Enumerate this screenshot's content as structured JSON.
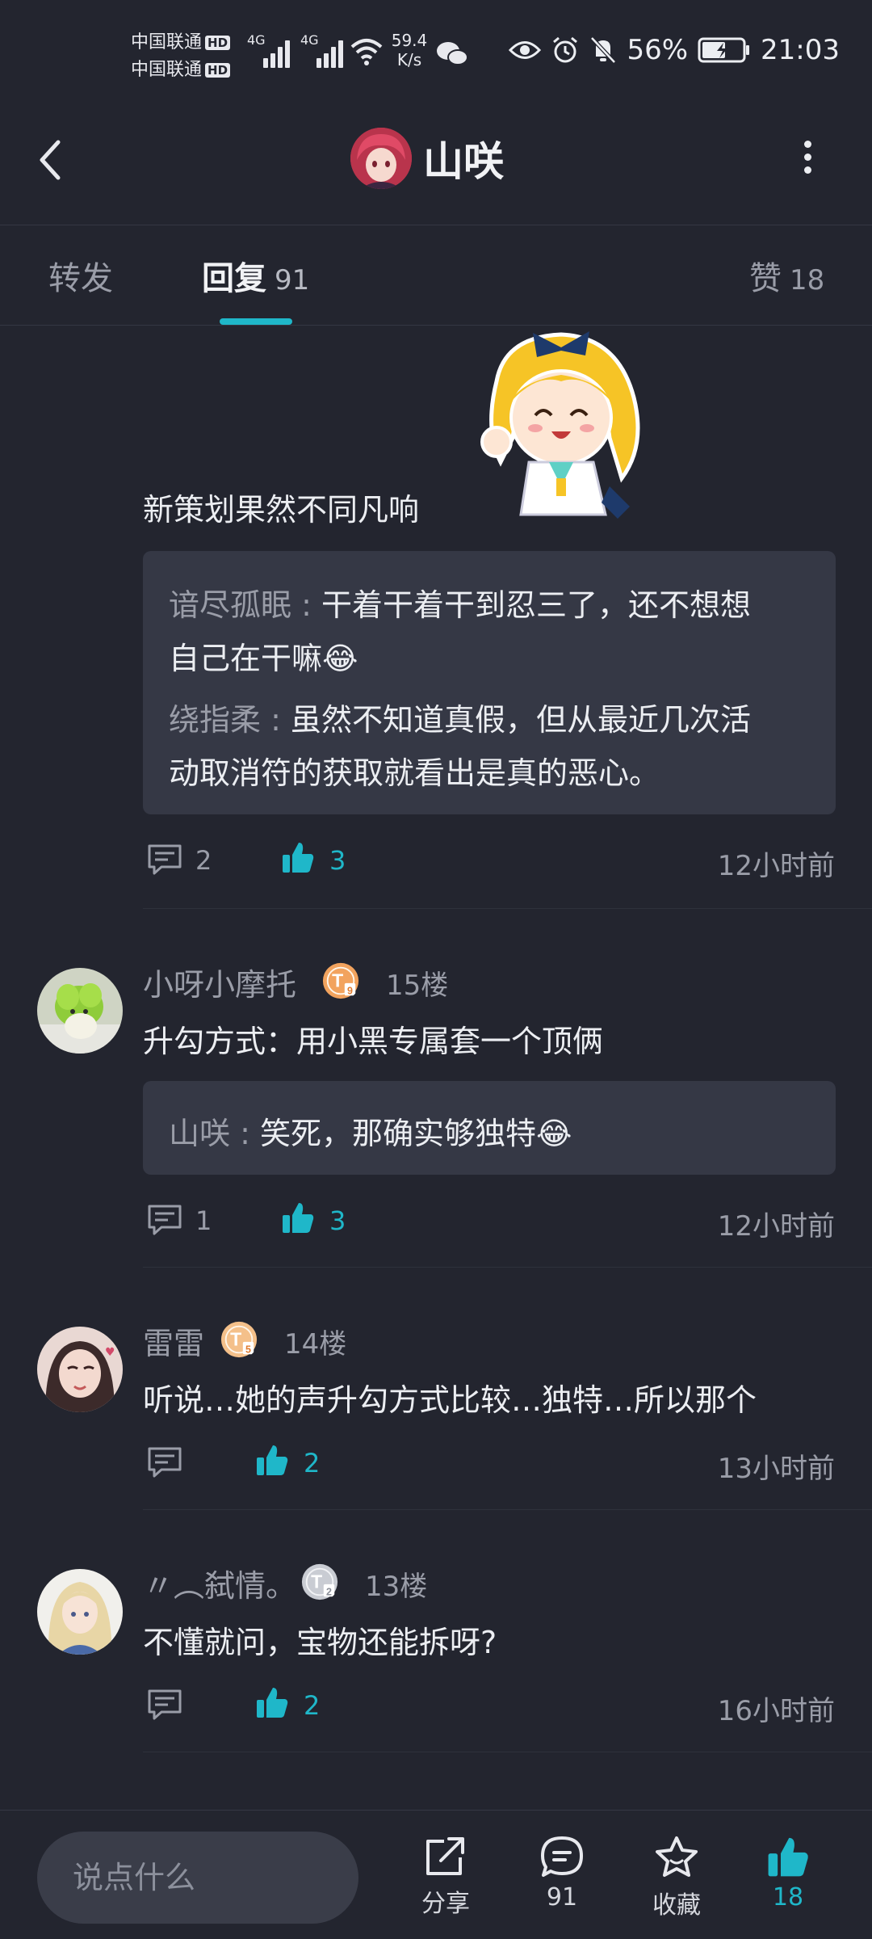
{
  "status_bar": {
    "carrier1": "中国联通",
    "carrier2": "中国联通",
    "hd": "HD",
    "net1": "4G",
    "net2": "4G",
    "speed_value": "59.4",
    "speed_unit": "K/s",
    "battery": "56%",
    "time": "21:03"
  },
  "header": {
    "title": "山咲"
  },
  "tabs": [
    {
      "label": "转发",
      "count": ""
    },
    {
      "label": "回复",
      "count": "91"
    },
    {
      "label": "赞",
      "count": "18"
    }
  ],
  "posts": [
    {
      "text": "新策划果然不同凡响",
      "replies": [
        {
          "name": "谙尽孤眠",
          "sep": " : ",
          "line1": "干着干着干到忍三了，还不想想",
          "line2": "自己在干嘛😂"
        },
        {
          "name": "绕指柔",
          "sep": " : ",
          "line1": "虽然不知道真假，但从最近几次活",
          "line2": "动取消符的获取就看出是真的恶心。"
        }
      ],
      "comments": "2",
      "likes": "3",
      "time": "12小时前"
    },
    {
      "user": "小呀小摩托",
      "level": "T",
      "level_num": "9",
      "floor": "15楼",
      "text": "升勾方式：用小黑专属套一个顶俩",
      "replies": [
        {
          "name": "山咲",
          "sep": " : ",
          "line1": "笑死，那确实够独特😂"
        }
      ],
      "comments": "1",
      "likes": "3",
      "time": "12小时前"
    },
    {
      "user": "雷雷",
      "level": "T",
      "level_num": "5",
      "floor": "14楼",
      "text": "听说…她的声升勾方式比较…独特…所以那个",
      "likes": "2",
      "time": "13小时前"
    },
    {
      "user": "〃︵弑情。",
      "level": "T",
      "level_num": "2",
      "floor": "13楼",
      "text": "不懂就问，宝物还能拆呀?",
      "likes": "2",
      "time": "16小时前"
    }
  ],
  "bottom_bar": {
    "input_placeholder": "说点什么",
    "share_label": "分享",
    "comments_count": "91",
    "favorite_label": "收藏",
    "likes_count": "18"
  },
  "colors": {
    "accent": "#1fb7c9",
    "background": "#23252f",
    "quote_bg": "#353845",
    "level_orange": "#f2a35e"
  }
}
